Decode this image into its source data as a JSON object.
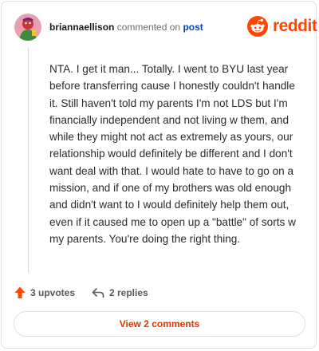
{
  "comment": {
    "author": "briannaellison",
    "action": "commented on",
    "target": "post",
    "body": "NTA. I get it man... Totally. I went to BYU last year before transferring cause I honestly couldn't handle it. Still haven't told my parents I'm not LDS but I'm financially independent and not living w them, and while they might not act as extremely as yours, our relationship would definitely be different and I don't want deal with that. I would hate to have to go on a mission, and if one of my brothers was old enough and didn't want to I would definitely help them out, even if it caused me to open up a \"battle\" of sorts w my parents. You're doing the right thing."
  },
  "brand": {
    "name": "reddit",
    "logo_icon": "reddit-snoo-icon",
    "color": "#ff4500"
  },
  "actions": {
    "upvotes_label": "3 upvotes",
    "upvote_icon": "upvote-arrow-icon",
    "upvote_color": "#ff4500",
    "replies_label": "2 replies",
    "reply_icon": "reply-arrow-icon"
  },
  "footer": {
    "view_comments_label": "View 2 comments",
    "accent": "#d93900"
  }
}
